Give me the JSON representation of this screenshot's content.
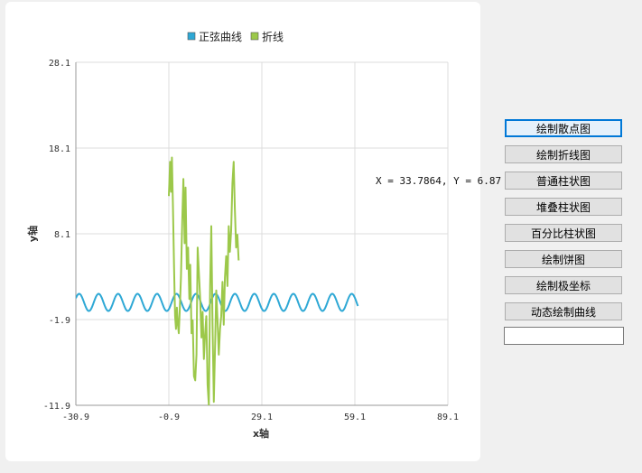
{
  "chart_data": {
    "type": "line",
    "title": "",
    "xlabel": "x轴",
    "ylabel": "y轴",
    "xlim": [
      -30.9,
      89.1
    ],
    "ylim": [
      -11.9,
      28.1
    ],
    "xticks": [
      "-30.9",
      "-0.9",
      "29.1",
      "59.1",
      "89.1"
    ],
    "yticks": [
      "-11.9",
      "-1.9",
      "8.1",
      "18.1",
      "28.1"
    ],
    "grid": true,
    "legend_position": "top-center",
    "series": [
      {
        "name": "正弦曲线",
        "color": "#2ea8d5",
        "kind": "sine",
        "x_start": -30.9,
        "x_end": 60.1,
        "amplitude": 1.0,
        "offset": 0.1,
        "period": 6.28
      },
      {
        "name": "折线",
        "color": "#9cc84a",
        "kind": "line",
        "points": [
          [
            -0.9,
            12.5
          ],
          [
            -0.5,
            16.5
          ],
          [
            -0.2,
            13.0
          ],
          [
            0.1,
            17.0
          ],
          [
            0.4,
            11.5
          ],
          [
            0.8,
            4.0
          ],
          [
            1.1,
            -1.5
          ],
          [
            1.4,
            -3.0
          ],
          [
            1.7,
            -0.5
          ],
          [
            2.0,
            -2.5
          ],
          [
            2.3,
            -3.5
          ],
          [
            2.6,
            -1.0
          ],
          [
            3.0,
            3.0
          ],
          [
            3.4,
            9.5
          ],
          [
            3.8,
            14.5
          ],
          [
            4.2,
            7.0
          ],
          [
            4.5,
            13.5
          ],
          [
            4.9,
            4.0
          ],
          [
            5.3,
            6.5
          ],
          [
            5.7,
            0.5
          ],
          [
            6.0,
            4.5
          ],
          [
            6.4,
            -3.5
          ],
          [
            6.8,
            -2.0
          ],
          [
            7.2,
            -8.5
          ],
          [
            7.6,
            -9.0
          ],
          [
            8.0,
            -6.0
          ],
          [
            8.4,
            6.5
          ],
          [
            8.8,
            3.5
          ],
          [
            9.2,
            0.5
          ],
          [
            9.6,
            -4.0
          ],
          [
            10.0,
            -1.0
          ],
          [
            10.4,
            -6.5
          ],
          [
            10.8,
            -3.5
          ],
          [
            11.2,
            -1.5
          ],
          [
            11.6,
            -9.5
          ],
          [
            12.0,
            -11.9
          ],
          [
            12.4,
            2.0
          ],
          [
            12.8,
            9.0
          ],
          [
            13.2,
            -2.5
          ],
          [
            13.6,
            -11.5
          ],
          [
            14.0,
            -5.0
          ],
          [
            14.4,
            1.5
          ],
          [
            14.8,
            -2.0
          ],
          [
            15.2,
            -6.0
          ],
          [
            15.6,
            -3.0
          ],
          [
            16.0,
            -1.5
          ],
          [
            16.4,
            2.5
          ],
          [
            16.8,
            -2.5
          ],
          [
            17.2,
            3.0
          ],
          [
            17.6,
            5.5
          ],
          [
            18.0,
            2.0
          ],
          [
            18.4,
            9.0
          ],
          [
            18.8,
            6.0
          ],
          [
            19.2,
            8.5
          ],
          [
            19.6,
            14.0
          ],
          [
            20.0,
            16.5
          ],
          [
            20.4,
            11.0
          ],
          [
            20.8,
            6.5
          ],
          [
            21.2,
            8.0
          ],
          [
            21.6,
            5.0
          ]
        ]
      }
    ]
  },
  "coordinate_readout": "X = 33.7864, Y = 6.87",
  "buttons": {
    "scatter": "绘制散点图",
    "line": "绘制折线图",
    "bar": "普通柱状图",
    "stacked_bar": "堆叠柱状图",
    "percent_bar": "百分比柱状图",
    "pie": "绘制饼图",
    "polar": "绘制极坐标",
    "dynamic_curve": "动态绘制曲线"
  },
  "input": {
    "value": ""
  }
}
